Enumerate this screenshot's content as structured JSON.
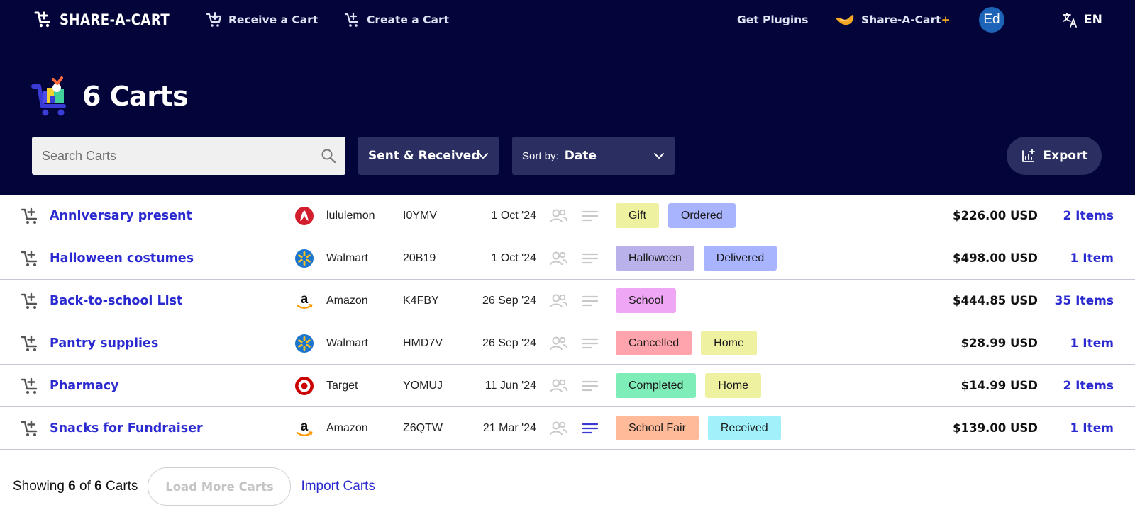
{
  "nav": {
    "brand": "SHARE-A-CART",
    "receive": "Receive a Cart",
    "create": "Create a Cart",
    "plugins": "Get Plugins",
    "plus_name": "Share-A-Cart",
    "plus_mark": "+",
    "avatar": "Ed",
    "language": "EN"
  },
  "page": {
    "title": "6 Carts"
  },
  "controls": {
    "search_placeholder": "Search Carts",
    "search_value": "",
    "filter_value": "Sent & Received",
    "sort_prefix": "Sort by:",
    "sort_value": "Date",
    "export_label": "Export"
  },
  "carts": [
    {
      "name": "Anniversary present",
      "store": "lululemon",
      "store_logo": "lululemon-logo",
      "code": "I0YMV",
      "date": "1 Oct '24",
      "has_notes": false,
      "tags": [
        {
          "label": "Gift",
          "color": "#eef2a0"
        },
        {
          "label": "Ordered",
          "color": "#a9b4ff"
        }
      ],
      "price": "$226.00 USD",
      "items": "2 Items"
    },
    {
      "name": "Halloween costumes",
      "store": "Walmart",
      "store_logo": "walmart-logo",
      "code": "20B19",
      "date": "1 Oct '24",
      "has_notes": false,
      "tags": [
        {
          "label": "Halloween",
          "color": "#b9b2ea"
        },
        {
          "label": "Delivered",
          "color": "#a9b4ff"
        }
      ],
      "price": "$498.00 USD",
      "items": "1 Item"
    },
    {
      "name": "Back-to-school List",
      "store": "Amazon",
      "store_logo": "amazon-logo",
      "code": "K4FBY",
      "date": "26 Sep '24",
      "has_notes": false,
      "tags": [
        {
          "label": "School",
          "color": "#efa6f4"
        }
      ],
      "price": "$444.85 USD",
      "items": "35 Items"
    },
    {
      "name": "Pantry supplies",
      "store": "Walmart",
      "store_logo": "walmart-logo",
      "code": "HMD7V",
      "date": "26 Sep '24",
      "has_notes": false,
      "tags": [
        {
          "label": "Cancelled",
          "color": "#ffa3ac"
        },
        {
          "label": "Home",
          "color": "#eef2a0"
        }
      ],
      "price": "$28.99 USD",
      "items": "1 Item"
    },
    {
      "name": "Pharmacy",
      "store": "Target",
      "store_logo": "target-logo",
      "code": "YOMUJ",
      "date": "11 Jun '24",
      "has_notes": false,
      "tags": [
        {
          "label": "Completed",
          "color": "#7eedb8"
        },
        {
          "label": "Home",
          "color": "#eef2a0"
        }
      ],
      "price": "$14.99 USD",
      "items": "2 Items"
    },
    {
      "name": "Snacks for Fundraiser",
      "store": "Amazon",
      "store_logo": "amazon-logo",
      "code": "Z6QTW",
      "date": "21 Mar '24",
      "has_notes": true,
      "tags": [
        {
          "label": "School Fair",
          "color": "#ffbb99"
        },
        {
          "label": "Received",
          "color": "#a1f1fb"
        }
      ],
      "price": "$139.00 USD",
      "items": "1 Item"
    }
  ],
  "footer": {
    "showing_prefix": "Showing",
    "showing_count": "6",
    "showing_of": "of",
    "showing_total": "6",
    "showing_suffix": "Carts",
    "load_more": "Load More Carts",
    "import": "Import Carts"
  },
  "colors": {
    "header_bg": "#03053a",
    "control_bg": "#2b2e60",
    "link_blue": "#2a2ad0",
    "accent_orange": "#f5a623",
    "notes_active": "#3a3ad0",
    "icon_muted": "#c8c8c8"
  }
}
